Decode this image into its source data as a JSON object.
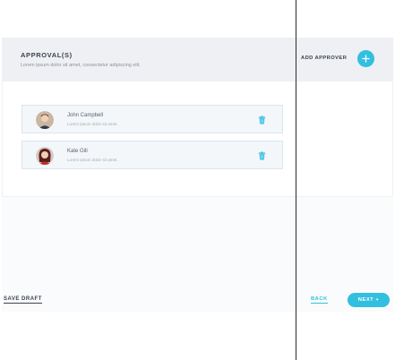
{
  "approvals": {
    "title": "APPROVAL(S)",
    "subtitle": "Lorem ipsum dolor sit amet, consectetur adipiscing elit.",
    "add_label": "ADD APPROVER",
    "add_icon": "plus-icon"
  },
  "approvers": [
    {
      "name": "John Campbell",
      "description": "Lorem ipsum dolor sit amet.",
      "icon": "trash-icon"
    },
    {
      "name": "Kate Gill",
      "description": "Lorem ipsum dolor sit amet.",
      "icon": "trash-icon"
    }
  ],
  "footer": {
    "save_draft": "SAVE DRAFT",
    "back": "BACK",
    "next": "NEXT +"
  },
  "colors": {
    "accent": "#33bfe0",
    "header_bg": "#eef0f3",
    "text": "#3c4250"
  }
}
